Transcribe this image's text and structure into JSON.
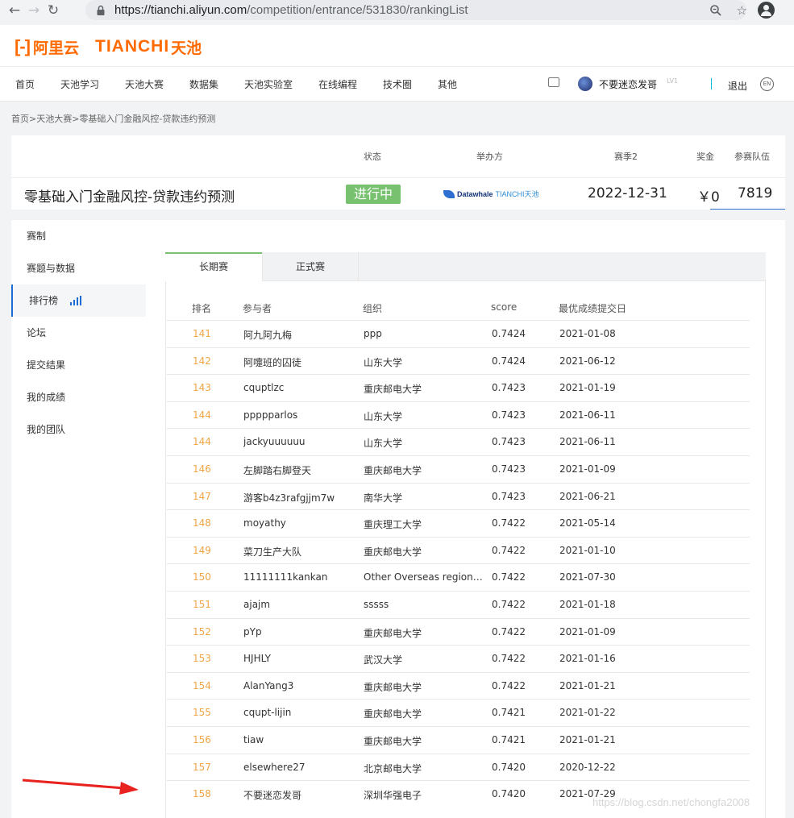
{
  "browser": {
    "url_host": "https://tianchi.aliyun.com",
    "url_path": "/competition/entrance/531830/rankingList"
  },
  "logo": {
    "bracket": "[-]",
    "aliyun": "阿里云",
    "tianchi": "TIANCHI",
    "tianchi_cn": "天池"
  },
  "nav": {
    "items": [
      "首页",
      "天池学习",
      "天池大赛",
      "数据集",
      "天池实验室",
      "在线编程",
      "技术圈",
      "其他"
    ]
  },
  "user": {
    "name": "不要迷恋发哥",
    "level": "LV1",
    "logout": "退出",
    "lang": "EN"
  },
  "breadcrumb": "首页>天池大赛>零基础入门金融风控-贷款违约预测",
  "competition": {
    "labels": {
      "status": "状态",
      "organizer": "举办方",
      "season": "赛季2",
      "prize": "奖金",
      "teams": "参赛队伍"
    },
    "title": "零基础入门金融风控-贷款违约预测",
    "status": "进行中",
    "organizer_main": "Datawhale",
    "organizer_sub": "TIANCHI天池",
    "date": "2022-12-31",
    "prize": "￥0",
    "teams": "7819"
  },
  "sidebar": {
    "items": [
      "赛制",
      "赛题与数据",
      "排行榜",
      "论坛",
      "提交结果",
      "我的成绩",
      "我的团队"
    ]
  },
  "tabs": [
    "长期赛",
    "正式赛"
  ],
  "table": {
    "headers": [
      "排名",
      "参与者",
      "组织",
      "score",
      "最优成绩提交日"
    ],
    "rows": [
      [
        "141",
        "阿九阿九梅",
        "ppp",
        "0.7424",
        "2021-01-08"
      ],
      [
        "142",
        "阿嚏班的囚徒",
        "山东大学",
        "0.7424",
        "2021-06-12"
      ],
      [
        "143",
        "cquptlzc",
        "重庆邮电大学",
        "0.7423",
        "2021-01-19"
      ],
      [
        "144",
        "ppppparlos",
        "山东大学",
        "0.7423",
        "2021-06-11"
      ],
      [
        "144",
        "jackyuuuuuu",
        "山东大学",
        "0.7423",
        "2021-06-11"
      ],
      [
        "146",
        "左脚踏右脚登天",
        "重庆邮电大学",
        "0.7423",
        "2021-01-09"
      ],
      [
        "147",
        "游客b4z3rafgjjm7w",
        "南华大学",
        "0.7423",
        "2021-06-21"
      ],
      [
        "148",
        "moyathy",
        "重庆理工大学",
        "0.7422",
        "2021-05-14"
      ],
      [
        "149",
        "菜刀生产大队",
        "重庆邮电大学",
        "0.7422",
        "2021-01-10"
      ],
      [
        "150",
        "11111111kankan",
        "Other Overseas regions-...",
        "0.7422",
        "2021-07-30"
      ],
      [
        "151",
        "ajajm",
        "sssss",
        "0.7422",
        "2021-01-18"
      ],
      [
        "152",
        "pYp",
        "重庆邮电大学",
        "0.7422",
        "2021-01-09"
      ],
      [
        "153",
        "HJHLY",
        "武汉大学",
        "0.7422",
        "2021-01-16"
      ],
      [
        "154",
        "AlanYang3",
        "重庆邮电大学",
        "0.7422",
        "2021-01-21"
      ],
      [
        "155",
        "cqupt-lijin",
        "重庆邮电大学",
        "0.7421",
        "2021-01-22"
      ],
      [
        "156",
        "tiaw",
        "重庆邮电大学",
        "0.7421",
        "2021-01-21"
      ],
      [
        "157",
        "elsewhere27",
        "北京邮电大学",
        "0.7420",
        "2020-12-22"
      ],
      [
        "158",
        "不要迷恋发哥",
        "深圳华强电子",
        "0.7420",
        "2021-07-29"
      ]
    ]
  },
  "watermark": "https://blog.csdn.net/chongfa2008",
  "colors": {
    "brand": "#ff6a00",
    "status_green": "#78c26f",
    "rank_orange": "#f0a547",
    "active_blue": "#1f6bd6",
    "arrow_red": "#e8231f"
  }
}
